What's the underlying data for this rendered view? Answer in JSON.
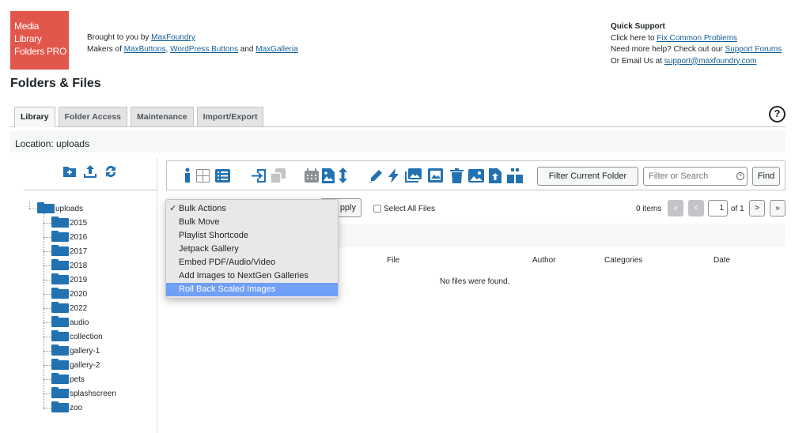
{
  "header": {
    "logo_lines": [
      "Media",
      "Library",
      "Folders PRO"
    ],
    "brought_prefix": "Brought to you by ",
    "brought_link": "MaxFoundry",
    "makers_prefix": "Makers of ",
    "makers_link1": "MaxButtons",
    "makers_sep1": ", ",
    "makers_link2": "WordPress Buttons",
    "makers_sep2": " and ",
    "makers_link3": "MaxGalleria",
    "support_title": "Quick Support",
    "support_line1_prefix": "Click here to ",
    "support_line1_link": "Fix Common Problems",
    "support_line2_prefix": "Need more help? Check out our ",
    "support_line2_link": "Support Forums",
    "support_line3_prefix": "Or Email Us at ",
    "support_line3_link": "support@maxfoundry.com"
  },
  "page_title": "Folders & Files",
  "tabs": [
    {
      "label": "Library",
      "active": true
    },
    {
      "label": "Folder Access",
      "active": false
    },
    {
      "label": "Maintenance",
      "active": false
    },
    {
      "label": "Import/Export",
      "active": false
    }
  ],
  "help_glyph": "?",
  "location": "Location: uploads",
  "folder_tree": {
    "root": "uploads",
    "children": [
      "2015",
      "2016",
      "2017",
      "2018",
      "2019",
      "2020",
      "2022",
      "audio",
      "collection",
      "gallery-1",
      "gallery-2",
      "pets",
      "splashscreen",
      "zoo"
    ]
  },
  "toolbar": {
    "filter_button": "Filter Current Folder",
    "search_placeholder": "Filter or Search",
    "search_clear": "×",
    "find_button": "Find",
    "icons": [
      "info-icon",
      "grid-view-icon",
      "list-view-icon",
      "move-icon",
      "copy-icon",
      "calendar-sort-icon",
      "image-sort-icon",
      "sort-order-icon",
      "rename-icon",
      "regenerate-thumbnails-icon",
      "gallery-icon",
      "image-seo-icon",
      "delete-icon",
      "image-icon",
      "upload-icon",
      "sync-icon"
    ]
  },
  "bulk": {
    "apply_label": "pply",
    "select_all": "Select All Files",
    "items_count": "0 items",
    "first": "«",
    "prev": "<",
    "page": "1",
    "of_total": "of 1",
    "next": ">",
    "last": "»"
  },
  "dropdown": {
    "check": "✓",
    "options": [
      {
        "label": "Bulk Actions",
        "checked": true,
        "highlighted": false
      },
      {
        "label": "Bulk Move",
        "checked": false,
        "highlighted": false
      },
      {
        "label": "Playlist Shortcode",
        "checked": false,
        "highlighted": false
      },
      {
        "label": "Jetpack Gallery",
        "checked": false,
        "highlighted": false
      },
      {
        "label": "Embed PDF/Audio/Video",
        "checked": false,
        "highlighted": false
      },
      {
        "label": "Add Images to NextGen Galleries",
        "checked": false,
        "highlighted": false
      },
      {
        "label": "Roll Back Scaled Images",
        "checked": false,
        "highlighted": true
      }
    ]
  },
  "columns": {
    "file": "File",
    "author": "Author",
    "categories": "Categories",
    "date": "Date"
  },
  "empty_message": "No files were found.",
  "colors": {
    "accent": "#2271b1",
    "logo_bg": "#e2574c",
    "dropdown_highlight": "#6f9ff7"
  }
}
